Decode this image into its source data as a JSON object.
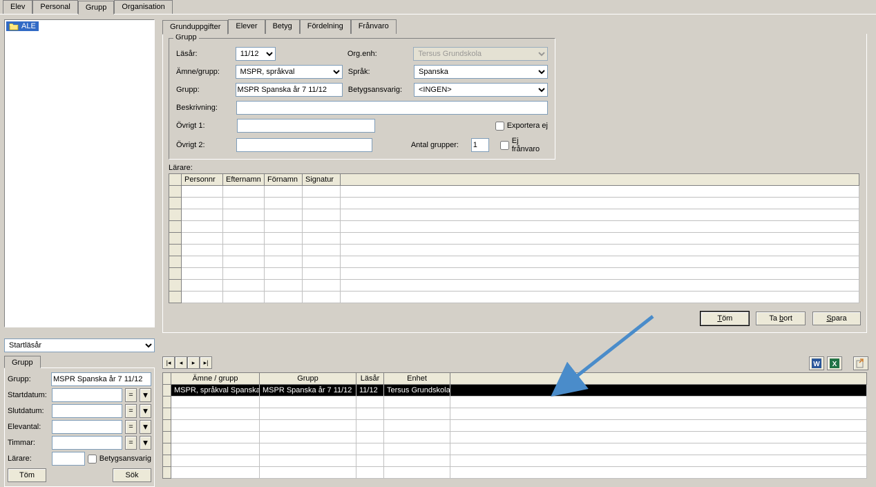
{
  "topTabs": {
    "elev": "Elev",
    "personal": "Personal",
    "grupp": "Grupp",
    "organisation": "Organisation"
  },
  "tree": {
    "selected": "ALE"
  },
  "innerTabs": {
    "grunduppgifter": "Grunduppgifter",
    "elever": "Elever",
    "betyg": "Betyg",
    "fordelning": "Fördelning",
    "franvaro": "Frånvaro"
  },
  "gruppForm": {
    "legend": "Grupp",
    "labels": {
      "lasar": "Läsår:",
      "orgenh": "Org.enh:",
      "amnegrupp": "Ämne/grupp:",
      "sprak": "Språk:",
      "grupp": "Grupp:",
      "betygsansvarig": "Betygsansvarig:",
      "beskrivning": "Beskrivning:",
      "ovrigt1": "Övrigt 1:",
      "ovrigt2": "Övrigt 2:",
      "antal_grupper": "Antal grupper:",
      "exportera_ej": "Exportera ej",
      "ej_franvaro": "Ej frånvaro"
    },
    "values": {
      "lasar": "11/12",
      "orgenh": "Tersus Grundskola",
      "amnegrupp": "MSPR, språkval",
      "sprak": "Spanska",
      "grupp": "MSPR Spanska år 7 11/12",
      "betygsansvarig": "<INGEN>",
      "beskrivning": "",
      "ovrigt1": "",
      "ovrigt2": "",
      "antal_grupper": "1",
      "exportera_ej": false,
      "ej_franvaro": false
    }
  },
  "larare": {
    "legend": "Lärare:",
    "columns": [
      "Personnr",
      "Efternamn",
      "Förnamn",
      "Signatur",
      ""
    ]
  },
  "buttons": {
    "tom": "Töm",
    "tabort": "Ta bort",
    "spara": "Spara",
    "sok": "Sök"
  },
  "startlasarPlaceholder": "Startläsår",
  "lowerLeftTab": "Grupp",
  "lowerLeftFields": {
    "grupp_label": "Grupp:",
    "grupp_value": "MSPR Spanska år 7 11/12",
    "startdatum": "Startdatum:",
    "slutdatum": "Slutdatum:",
    "elevantal": "Elevantal:",
    "timmar": "Timmar:",
    "larare": "Lärare:",
    "betygsansvarig_cb": "Betygsansvarig"
  },
  "resultsGrid": {
    "columns": {
      "amne_grupp": "Ämne / grupp",
      "grupp": "Grupp",
      "lasar": "Läsår",
      "enhet": "Enhet"
    },
    "row": {
      "amne_grupp": "MSPR, språkval Spanska",
      "grupp": "MSPR Spanska år 7 11/12",
      "lasar": "11/12",
      "enhet": "Tersus Grundskola"
    }
  },
  "iconNames": {
    "folder": "folder-icon",
    "word": "word-icon",
    "excel": "excel-icon",
    "export": "export-icon"
  }
}
